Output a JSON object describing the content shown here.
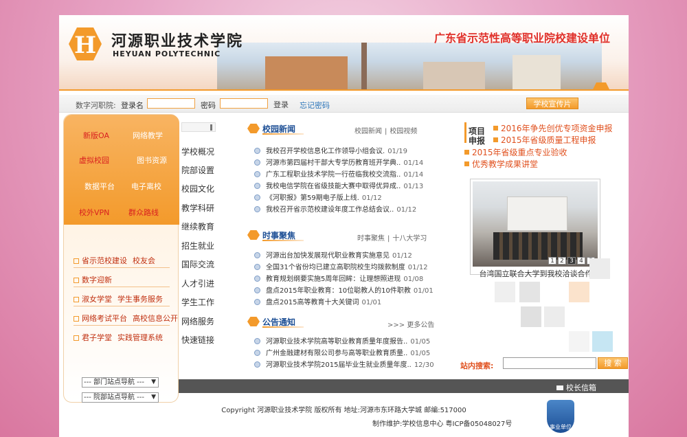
{
  "header": {
    "logo_cn": "河源职业技术学院",
    "logo_en": "HEYUAN POLYTECHNIC",
    "slogan": "广东省示范性高等职业院校建设单位"
  },
  "login": {
    "portal_label": "数字河职院:",
    "username_label": "登录名",
    "password_label": "密码",
    "login_button": "登录",
    "forgot_link": "忘记密码",
    "promo_button": "学校宣传片"
  },
  "left_panel": {
    "quick_links": [
      {
        "label": "新版OA",
        "highlight": true
      },
      {
        "label": "网络教学",
        "highlight": false
      },
      {
        "label": "虚拟校园",
        "highlight": true
      },
      {
        "label": "图书资源",
        "highlight": false
      },
      {
        "label": "数据平台",
        "highlight": false
      },
      {
        "label": "电子离校",
        "highlight": false
      },
      {
        "label": "校外VPN",
        "highlight": true
      },
      {
        "label": "群众路线",
        "highlight": true
      }
    ],
    "list_links": [
      [
        "省示范校建设",
        "校友会"
      ],
      [
        "数字迎新",
        ""
      ],
      [
        "淑女学堂",
        "学生事务服务"
      ],
      [
        "网络考试平台",
        "高校信息公开"
      ],
      [
        "君子学堂",
        "实践管理系统"
      ]
    ],
    "select_dept": "--- 部门站点导航 ---",
    "select_faculty": "--- 院部站点导航 ---"
  },
  "nav": {
    "items": [
      "学校概况",
      "院部设置",
      "校园文化",
      "教学科研",
      "继续教育",
      "招生就业",
      "国际交流",
      "人才引进",
      "学生工作",
      "网络服务",
      "快速链接"
    ]
  },
  "campus_news": {
    "title": "校园新闻",
    "links": [
      "校园新闻",
      "校园视频"
    ],
    "items": [
      {
        "text": "我校召开学校信息化工作领导小组会议.",
        "date": "01/19"
      },
      {
        "text": "河源市第四届村干部大专学历教育班开学典..",
        "date": "01/14"
      },
      {
        "text": "广东工程职业技术学院一行莅临我校交流指..",
        "date": "01/14"
      },
      {
        "text": "我校电信学院在省级技能大赛中取得优异成..",
        "date": "01/13"
      },
      {
        "text": "《河职报》第59期电子版上线.",
        "date": "01/12"
      },
      {
        "text": "我校召开省示范校建设年度工作总结会议..",
        "date": "01/12"
      }
    ]
  },
  "current_news": {
    "title": "时事聚焦",
    "links": [
      "时事聚焦",
      "十八大学习"
    ],
    "items": [
      {
        "text": "河源出台加快发展现代职业教育实施意见",
        "date": "01/12"
      },
      {
        "text": "全国31个省份均已建立高职院校生均拨款制度",
        "date": "01/12"
      },
      {
        "text": "教育规划纲要实施5周年回眸：让理想照进现",
        "date": "01/08"
      },
      {
        "text": "盘点2015年职业教育：10位聪教人的10件职教",
        "date": "01/01"
      },
      {
        "text": "盘点2015高等教育十大关键词",
        "date": "01/01"
      }
    ]
  },
  "notices": {
    "title": "公告通知",
    "more": ">>> 更多公告",
    "items": [
      {
        "text": "河源职业技术学院高等职业教育质量年度报告..",
        "date": "01/05"
      },
      {
        "text": "广州金融建材有限公司参与高等职业教育质量..",
        "date": "01/05"
      },
      {
        "text": "河源职业技术学院2015届毕业生就业质量年度..",
        "date": "12/30"
      }
    ]
  },
  "right": {
    "project_label": "项目申报",
    "links": [
      "2016年争先创优专项资金申报",
      "2015年省级质量工程申报",
      "2015年省级重点专业验收",
      "优秀教学成果讲堂"
    ],
    "photo_pages": [
      "1",
      "2",
      "3",
      "4",
      "5"
    ],
    "active_page": "3",
    "photo_caption": "台湾国立联合大学到我校洽谈合作",
    "search_label": "站内搜索:",
    "search_button": "搜 索"
  },
  "footer": {
    "mailbox": "校长信箱",
    "copyright": "Copyright 河源职业技术学院 版权所有 地址:河源市东环路大学城 邮编:517000",
    "maintain": "制作维护:学校信息中心 粤ICP备05048027号",
    "badge": "事业单位"
  },
  "colors": {
    "accent": "#f39a2b",
    "title_blue": "#1d4f95",
    "red": "#e0302a"
  }
}
